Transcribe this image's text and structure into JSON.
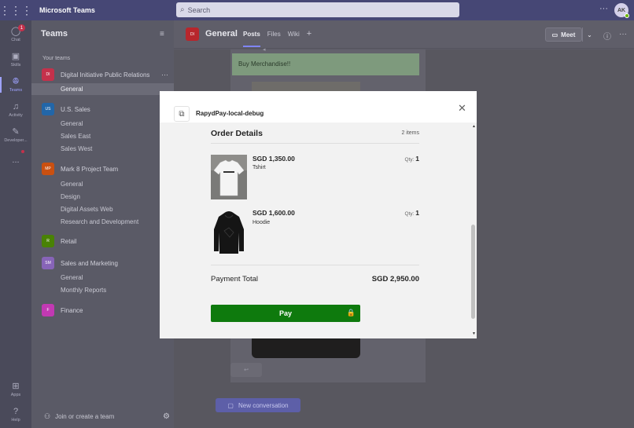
{
  "app": {
    "title": "Microsoft Teams",
    "avatar_initials": "AK"
  },
  "search": {
    "placeholder": "Search"
  },
  "rail": [
    {
      "label": "Chat",
      "icon": "chat-icon",
      "badge": "1"
    },
    {
      "label": "Skills",
      "icon": "skills-icon"
    },
    {
      "label": "Teams",
      "icon": "teams-icon",
      "active": true
    },
    {
      "label": "Activity",
      "icon": "bell-icon"
    },
    {
      "label": "Developer...",
      "icon": "developer-icon"
    },
    {
      "label": "...",
      "icon": "more-apps-icon"
    },
    {
      "label": "Apps",
      "icon": "apps-icon"
    },
    {
      "label": "Help",
      "icon": "help-icon"
    }
  ],
  "panel": {
    "title": "Teams",
    "section_label": "Your teams",
    "teams": [
      {
        "initials": "DI",
        "name": "Digital Initiative Public Relations",
        "color": "#c4314b",
        "channels": [
          "General"
        ]
      },
      {
        "initials": "US",
        "name": "U.S. Sales",
        "color": "#2266a8",
        "channels": [
          "General",
          "Sales East",
          "Sales West"
        ]
      },
      {
        "initials": "MP",
        "name": "Mark 8 Project Team",
        "color": "#ca5010",
        "channels": [
          "General",
          "Design",
          "Digital Assets Web",
          "Research and Development"
        ]
      },
      {
        "initials": "R",
        "name": "Retail",
        "color": "#498205",
        "channels": []
      },
      {
        "initials": "SM",
        "name": "Sales and Marketing",
        "color": "#8764b8",
        "channels": [
          "General",
          "Monthly Reports"
        ]
      },
      {
        "initials": "F",
        "name": "Finance",
        "color": "#c239b3",
        "channels": []
      }
    ],
    "footer": "Join or create a team"
  },
  "channel": {
    "initials": "DI",
    "name": "General",
    "tabs": [
      "Posts",
      "Files",
      "Wiki"
    ],
    "meet_label": "Meet"
  },
  "post": {
    "message": "Buy Merchandise!!",
    "new_conversation": "New conversation"
  },
  "modal": {
    "app_name": "RapydPay-local-debug",
    "order_title": "Order Details",
    "item_count": "2 items",
    "items": [
      {
        "price": "SGD 1,350.00",
        "name": "Tshirt",
        "qty_label": "Qty:",
        "qty": "1"
      },
      {
        "price": "SGD 1,600.00",
        "name": "Hoodie",
        "qty_label": "Qty:",
        "qty": "1"
      }
    ],
    "total_label": "Payment Total",
    "total_value": "SGD 2,950.00",
    "pay_label": "Pay"
  },
  "colors": {
    "pay_green": "#0e7a0d",
    "topbar": "#464775",
    "accent": "#7f85f5"
  }
}
